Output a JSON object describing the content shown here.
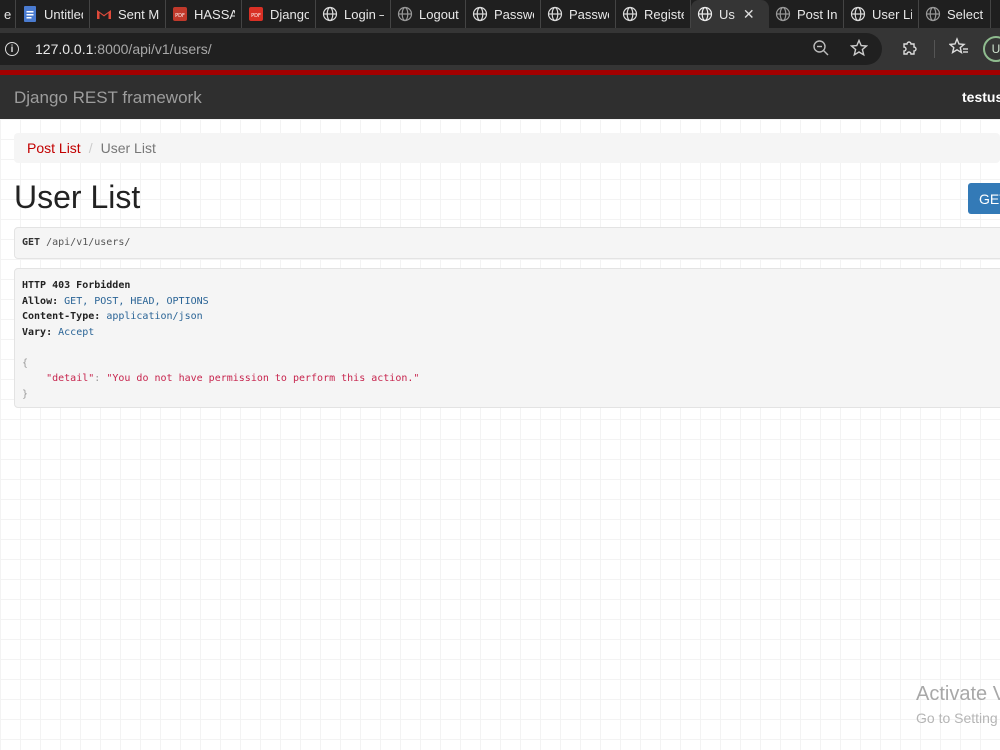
{
  "browser": {
    "tabs": [
      {
        "label": "e -",
        "icon": "partial-tab",
        "active": false
      },
      {
        "label": "Untitled",
        "icon": "docs-icon",
        "active": false
      },
      {
        "label": "Sent Ma",
        "icon": "gmail-icon",
        "active": false
      },
      {
        "label": "HASSAN",
        "icon": "pdf-icon",
        "active": false
      },
      {
        "label": "Django",
        "icon": "pdf-icon",
        "active": false
      },
      {
        "label": "Login –",
        "icon": "globe-icon",
        "active": false
      },
      {
        "label": "Logout",
        "icon": "globe-icon",
        "active": false
      },
      {
        "label": "Passwo",
        "icon": "globe-icon",
        "active": false
      },
      {
        "label": "Passwo",
        "icon": "globe-icon",
        "active": false
      },
      {
        "label": "Registe",
        "icon": "globe-icon",
        "active": false
      },
      {
        "label": "Us",
        "icon": "globe-icon",
        "active": true
      },
      {
        "label": "Post Ins",
        "icon": "globe-icon",
        "active": false
      },
      {
        "label": "User Lis",
        "icon": "globe-icon",
        "active": false
      },
      {
        "label": "Select u",
        "icon": "globe-icon",
        "active": false
      }
    ],
    "close_glyph": "✕",
    "url_host": "127.0.0.1",
    "url_rest": ":8000/api/v1/users/",
    "info_glyph": "i",
    "profile_initial": "U"
  },
  "navbar": {
    "brand": "Django REST framework",
    "username": "testuse"
  },
  "breadcrumb": {
    "link": "Post List",
    "separator": "/",
    "active": "User List"
  },
  "page": {
    "title": "User List",
    "get_button": "GET"
  },
  "request": {
    "method": "GET",
    "path": "/api/v1/users/"
  },
  "response": {
    "status": "HTTP 403 Forbidden",
    "headers": [
      {
        "name": "Allow:",
        "value": "GET, POST, HEAD, OPTIONS"
      },
      {
        "name": "Content-Type:",
        "value": "application/json"
      },
      {
        "name": "Vary:",
        "value": "Accept"
      }
    ],
    "open_brace": "{",
    "body_key": "\"detail\"",
    "body_colon": ":",
    "body_value": "\"You do not have permission to perform this action.\"",
    "close_brace": "}"
  },
  "watermark": {
    "line1": "Activate V",
    "line2": "Go to Setting"
  },
  "colors": {
    "accent_red": "#a30000",
    "link_red": "#c20000",
    "button_blue": "#337ab7",
    "navbar": "#2f2f2f"
  }
}
